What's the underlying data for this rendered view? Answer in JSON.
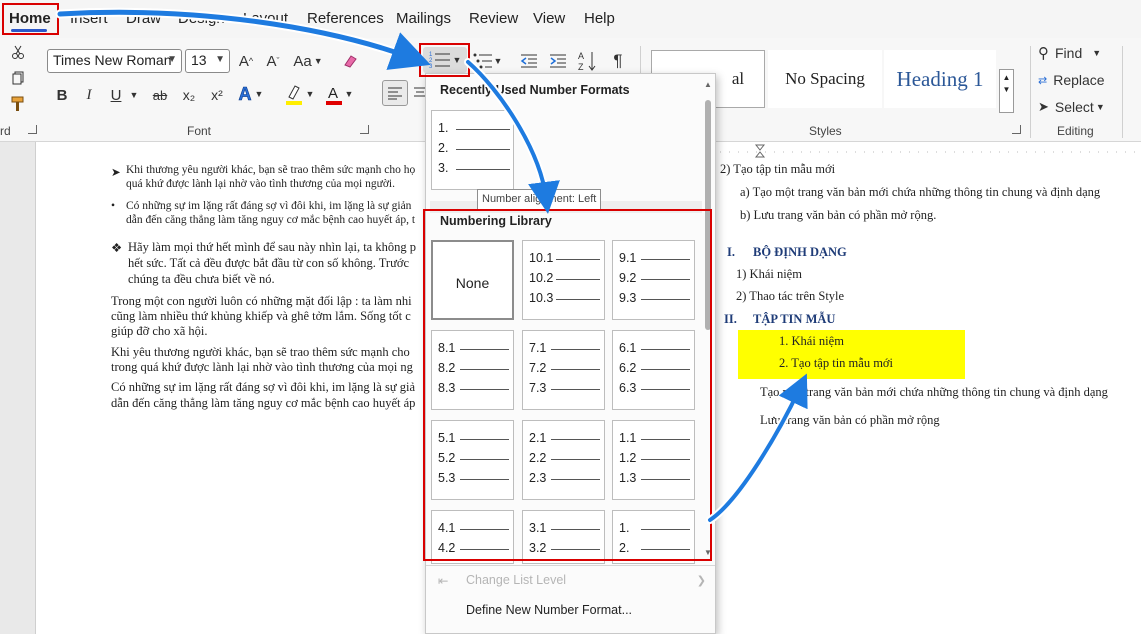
{
  "menu": {
    "tabs": [
      "Home",
      "Insert",
      "Draw",
      "Design",
      "Layout",
      "References",
      "Mailings",
      "Review",
      "View",
      "Help"
    ]
  },
  "ribbon": {
    "font_name": "Times New Roman",
    "font_size": "13",
    "font_group_label": "Font",
    "clipboard_label_fragment": "rd",
    "styles": {
      "label": "Styles",
      "items": [
        "Normal",
        "No Spacing",
        "Heading 1"
      ],
      "normal_fragment": "al"
    },
    "editing": {
      "label": "Editing",
      "find": "Find",
      "replace": "Replace",
      "select": "Select"
    },
    "buttons": {
      "bold": "B",
      "italic": "I",
      "underline": "U",
      "strike": "ab",
      "subscript": "x₂",
      "superscript": "x²",
      "grow": "A^",
      "shrink": "A˅",
      "case": "Aa",
      "pilcrow": "¶"
    }
  },
  "dropdown": {
    "recent_title": "Recently Used Number Formats",
    "recent_items": [
      "1.",
      "2.",
      "3."
    ],
    "tooltip": "Number alignment: Left",
    "library_title": "Numbering Library",
    "none_label": "None",
    "cards": [
      [
        "10.1",
        "10.2",
        "10.3"
      ],
      [
        "9.1",
        "9.2",
        "9.3"
      ],
      [
        "8.1",
        "8.2",
        "8.3"
      ],
      [
        "7.1",
        "7.2",
        "7.3"
      ],
      [
        "6.1",
        "6.2",
        "6.3"
      ],
      [
        "5.1",
        "5.2",
        "5.3"
      ],
      [
        "2.1",
        "2.2",
        "2.3"
      ],
      [
        "1.1",
        "1.2",
        "1.3"
      ],
      [
        "4.1",
        "4.2"
      ],
      [
        "3.1",
        "3.2"
      ],
      [
        "1.",
        "2."
      ]
    ],
    "change_level": "Change List Level",
    "define_new": "Define New Number Format..."
  },
  "doc_left": {
    "lines": [
      "Khi thương yêu người khác, bạn sẽ trao thêm sức mạnh cho họ",
      "quá khứ được lành lại nhờ vào tình thương của mọi người.",
      "Có những sự im lặng rất đáng sợ vì đôi khi, im lặng là sự giản",
      "dẫn đến căng thẳng làm tăng nguy cơ mắc bệnh cao huyết áp, t",
      "Hãy làm mọi thứ hết mình để sau này nhìn lại, ta không p",
      "hết sức. Tất cả đều được bắt đầu từ con số không. Trước",
      "chúng ta đều chưa biết về nó.",
      "Trong một con người luôn có những mặt đối lập : ta làm nhi",
      "cũng làm nhiều thứ khủng khiếp và ghê tởm lắm. Sống tốt c",
      "giúp đỡ cho xã hội.",
      "Khi yêu thương người khác, bạn sẽ trao thêm sức mạnh cho",
      "trong quá khứ được lành lại nhờ vào tình thương của mọi ng",
      "Có những sự im lặng rất đáng sợ vì đôi khi, im lặng là sự giả",
      "dẫn đến căng thẳng làm tăng nguy cơ mắc bệnh cao huyết áp"
    ]
  },
  "doc_right": {
    "lines": [
      "2)  Tạo tập tin mẫu mới",
      "a)  Tạo một trang văn bản mới chứa những thông tin chung và định dạng",
      "b)  Lưu trang văn bản có phần mở rộng.",
      "I.",
      "BỘ ĐỊNH DẠNG",
      "1)  Khái niệm",
      "2)  Thao tác trên Style",
      "II.",
      "TẬP TIN MẪU",
      "1.   Khái niệm",
      "2.   Tạo tập tin mẫu mới",
      "Tạo mới trang văn bản mới chứa những thông tin chung và định dạng",
      "Lưu trang văn bản có phần mở rộng"
    ]
  },
  "colors": {
    "annotation_red": "#d90000",
    "arrow_blue": "#1e7be0",
    "highlight_yellow": "#ffff00",
    "heading_blue": "#2b5797"
  }
}
